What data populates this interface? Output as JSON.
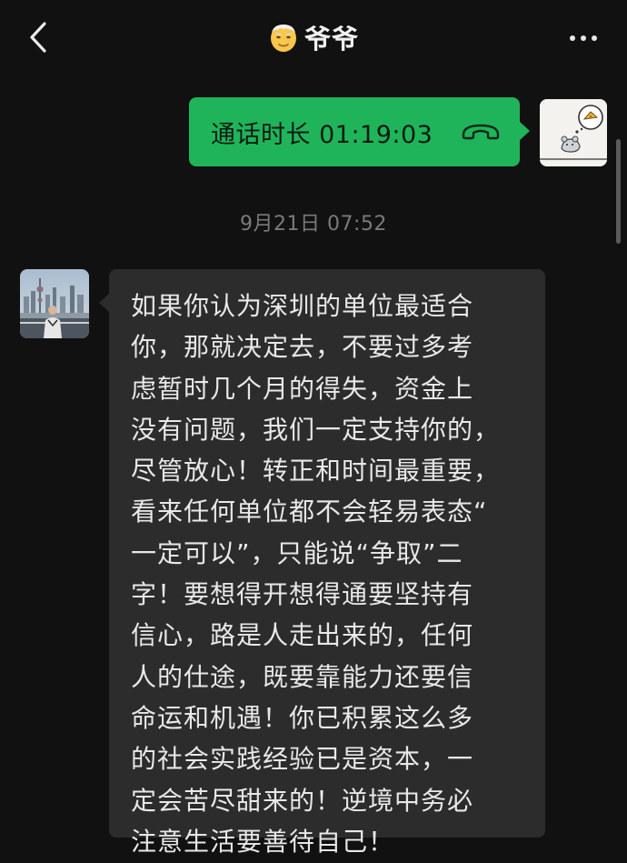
{
  "header": {
    "back_icon": "chevron-left-icon",
    "title_emoji_icon": "grandpa-emoji-icon",
    "title": "爷爷",
    "more_icon": "more-dots-icon"
  },
  "colors": {
    "background": "#111111",
    "outgoing_bubble": "#1fb45a",
    "incoming_bubble": "#2c2c2c",
    "timestamp_text": "#7a7a7a"
  },
  "messages": {
    "outgoing_call": {
      "text": "通话时长 01:19:03",
      "icon": "phone-hangup-icon"
    },
    "timestamp": "9月21日 07:52",
    "incoming": {
      "lines": [
        "如果你认为深圳的单位最适合",
        "你，那就决定去，不要过多考",
        "虑暂时几个月的得失，资金上",
        "没有问题，我们一定支持你的，",
        "尽管放心！转正和时间最重要，",
        "看来任何单位都不会轻易表态“",
        "一定可以”，只能说“争取”二",
        "字！要想得开想得通要坚持有",
        "信心，路是人走出来的，任何",
        "人的仕途，既要靠能力还要信",
        "命运和机遇！你已积累这么多",
        "的社会实践经验已是资本，一",
        "定会苦尽甜来的！逆境中务必",
        "注意生活要善待自己！"
      ]
    }
  }
}
